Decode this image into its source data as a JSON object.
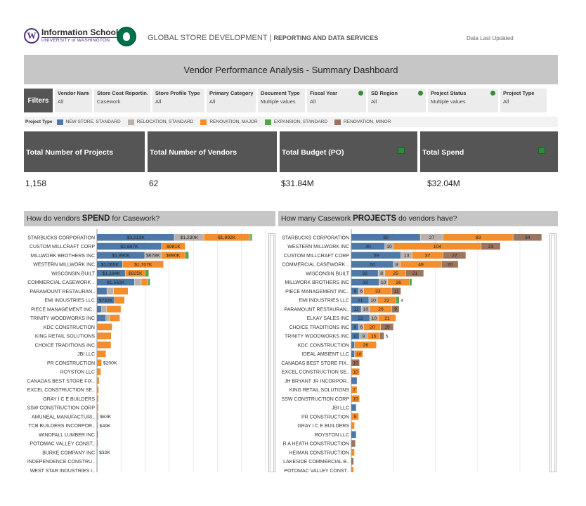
{
  "header": {
    "uw_name": "Information School",
    "uw_sub": "UNIVERSITY of WASHINGTON",
    "org_name": "GLOBAL STORE DEVELOPMENT",
    "org_sub": "REPORTING AND DATA SERVICES",
    "data_updated": "Data Last Updated"
  },
  "title": "Vendor Performance Analysis - Summary Dashboard",
  "filters": {
    "label": "Filters",
    "items": [
      {
        "title": "Vendor Name",
        "value": "All",
        "info": false
      },
      {
        "title": "Store Cost Reportin..",
        "value": "Casework",
        "info": false
      },
      {
        "title": "Store Profile Type",
        "value": "All",
        "info": false
      },
      {
        "title": "Primary Category",
        "value": "All",
        "info": false
      },
      {
        "title": "Document Type",
        "value": "Multiple values",
        "info": false
      },
      {
        "title": "Fiscal Year",
        "value": "All",
        "info": true
      },
      {
        "title": "SD Region",
        "value": "All",
        "info": true
      },
      {
        "title": "Project Status",
        "value": "Multiple values",
        "info": true
      },
      {
        "title": "Project Type",
        "value": "All",
        "info": false
      }
    ]
  },
  "legend": {
    "title": "Project Type",
    "items": [
      {
        "label": "NEW STORE, STANDARD",
        "color": "#4e79a7"
      },
      {
        "label": "RELOCATION, STANDARD",
        "color": "#bab0ac"
      },
      {
        "label": "RENOVATION, MAJOR",
        "color": "#f28e2b"
      },
      {
        "label": "EXPANSION, STANDARD",
        "color": "#59a14f"
      },
      {
        "label": "RENOVATION, MINOR",
        "color": "#9c755f"
      }
    ]
  },
  "kpis": [
    {
      "label": "Total Number of Projects",
      "value": "1,158"
    },
    {
      "label": "Total Number of Vendors",
      "value": "62"
    },
    {
      "label": "Total Budget (PO)",
      "value": "$31.84M"
    },
    {
      "label": "Total Spend",
      "value": "$32.04M"
    }
  ],
  "spend_panel": {
    "pre": "How do vendors ",
    "bold": "SPEND",
    "post": " for Casework?"
  },
  "projects_panel": {
    "pre": "How many Casework ",
    "bold": "PROJECTS",
    "post": " do vendors have?"
  },
  "chart_data": [
    {
      "type": "bar",
      "orientation": "horizontal",
      "stacked": true,
      "title": "How do vendors SPEND for Casework?",
      "units": "$K",
      "series_order": [
        "NEW STORE, STANDARD",
        "RELOCATION, STANDARD",
        "RENOVATION, MAJOR",
        "EXPANSION, STANDARD",
        "RENOVATION, MINOR"
      ],
      "categories": [
        "STARBUCKS CORPORATION",
        "CUSTOM MILLCRAFT CORP",
        "MILLWORK BROTHERS INC",
        "WESTERN MILLWORK INC",
        "WISCONSIN BUILT",
        "COMMERCIAL CASEWORK ..",
        "PARAMOUNT RESTAURAN..",
        "EMI INDUSTRIES LLC",
        "PIECE MANAGEMENT INC..",
        "TRINITY WOODWORKS INC",
        "KDC CONSTRUCTION",
        "KING RETAIL SOLUTIONS",
        "CHOICE TRADITIONS INC",
        "JBI LLC",
        "PR CONSTRUCTION",
        "ROYSTON LLC",
        "CANADAS BEST STORE FIX..",
        "EXCEL CONSTRUCTION SE..",
        "GRAY I C E BUILDERS",
        "SSW CONSTRUCTION CORP",
        "AMUNEAL MANUFACTURI..",
        "TCB BUILDERS INCORPOR..",
        "WINDFALL LUMBER INC",
        "POTOMAC VALLEY CONST..",
        "BURKE COMPANY INC",
        "INDEPENDENCE CONSTRU..",
        "WEST STAR INDUSTRIES I.."
      ],
      "values": [
        [
          3213,
          1230,
          1892,
          60,
          60
        ],
        [
          2687,
          0,
          981,
          0,
          0
        ],
        [
          1990,
          678,
          990,
          160,
          0
        ],
        [
          1065,
          0,
          1707,
          0,
          0
        ],
        [
          1184,
          0,
          825,
          150,
          0
        ],
        [
          1562,
          280,
          280,
          90,
          0
        ],
        [
          420,
          280,
          600,
          0,
          0
        ],
        [
          732,
          0,
          420,
          0,
          0
        ],
        [
          200,
          200,
          600,
          0,
          0
        ],
        [
          380,
          150,
          430,
          0,
          0
        ],
        [
          0,
          0,
          640,
          0,
          0
        ],
        [
          0,
          0,
          600,
          0,
          0
        ],
        [
          0,
          0,
          590,
          0,
          0
        ],
        [
          0,
          0,
          380,
          0,
          0
        ],
        [
          0,
          0,
          200,
          0,
          0
        ],
        [
          0,
          0,
          170,
          0,
          0
        ],
        [
          0,
          0,
          100,
          0,
          0
        ],
        [
          0,
          0,
          80,
          0,
          0
        ],
        [
          0,
          0,
          70,
          0,
          0
        ],
        [
          0,
          0,
          65,
          0,
          0
        ],
        [
          0,
          0,
          63,
          0,
          0
        ],
        [
          0,
          0,
          49,
          0,
          0
        ],
        [
          45,
          0,
          0,
          0,
          0
        ],
        [
          40,
          0,
          0,
          0,
          0
        ],
        [
          32,
          0,
          0,
          0,
          0
        ],
        [
          25,
          0,
          0,
          0,
          0
        ],
        [
          20,
          0,
          0,
          0,
          0
        ]
      ],
      "labels": [
        [
          "$3,213K",
          "$1,230K",
          "$1,892K",
          "",
          ""
        ],
        [
          "$2,687K",
          "",
          "$981K",
          "",
          ""
        ],
        [
          "$1,990K",
          "$678K",
          "$990K",
          "",
          ""
        ],
        [
          "$1,065K",
          "",
          "$1,707K",
          "",
          ""
        ],
        [
          "$1,184K",
          "",
          "$825K",
          "",
          ""
        ],
        [
          "$1,562K",
          "",
          "",
          "",
          ""
        ],
        [
          "",
          "",
          "",
          "",
          ""
        ],
        [
          "$732K",
          "",
          "",
          "",
          ""
        ],
        [
          "",
          "",
          "",
          "",
          ""
        ],
        [
          "",
          "",
          "",
          "",
          ""
        ],
        [
          "",
          "",
          "",
          "",
          ""
        ],
        [
          "",
          "",
          "",
          "",
          ""
        ],
        [
          "",
          "",
          "",
          "",
          ""
        ],
        [
          "",
          "",
          "",
          "",
          ""
        ],
        [
          "",
          "",
          "$200K",
          "",
          ""
        ],
        [
          "",
          "",
          "",
          "",
          ""
        ],
        [
          "",
          "",
          "",
          "",
          ""
        ],
        [
          "",
          "",
          "",
          "",
          ""
        ],
        [
          "",
          "",
          "",
          "",
          ""
        ],
        [
          "",
          "",
          "",
          "",
          ""
        ],
        [
          "",
          "",
          "$63K",
          "",
          ""
        ],
        [
          "",
          "",
          "$49K",
          "",
          ""
        ],
        [
          "",
          "",
          "",
          "",
          ""
        ],
        [
          "",
          "",
          "",
          "",
          ""
        ],
        [
          "$32K",
          "",
          "",
          "",
          ""
        ],
        [
          "",
          "",
          "",
          "",
          ""
        ],
        [
          "",
          "",
          "",
          "",
          ""
        ]
      ],
      "xlim": [
        0,
        7000
      ]
    },
    {
      "type": "bar",
      "orientation": "horizontal",
      "stacked": true,
      "title": "How many Casework PROJECTS do vendors have?",
      "series_order": [
        "NEW STORE, STANDARD",
        "RELOCATION, STANDARD",
        "RENOVATION, MAJOR",
        "EXPANSION, STANDARD",
        "RENOVATION, MINOR"
      ],
      "categories": [
        "STARBUCKS CORPORATION",
        "WESTERN MILLWORK INC",
        "CUSTOM MILLCRAFT CORP",
        "COMMERCIAL CASEWORK ..",
        "WISCONSIN BUILT",
        "MILLWORK BROTHERS INC",
        "PIECE MANAGEMENT INC..",
        "EMI INDUSTRIES LLC",
        "PARAMOUNT RESTAURAN..",
        "ELKAY SALES INC",
        "CHOICE TRADITIONS INC",
        "TRINITY WOODWORKS INC",
        "KDC CONSTRUCTION",
        "IDEAL AMBIENT LLC",
        "CANADAS BEST STORE FIX..",
        "EXCEL CONSTRUCTION SE..",
        "JH BRYANT JR INCORPOR..",
        "KING RETAIL SOLUTIONS",
        "SSW CONSTRUCTION CORP",
        "JBI LLC",
        "PR CONSTRUCTION",
        "GRAY I C E BUILDERS",
        "ROYSTON LLC",
        "R A HEATH CONSTRUCTION",
        "HEIMAN CONSTRUCTION",
        "LAKESIDE COMMERCIAL B..",
        "POTOMAC VALLEY CONST.."
      ],
      "values": [
        [
          82,
          27,
          83,
          0,
          34
        ],
        [
          40,
          10,
          104,
          0,
          23
        ],
        [
          59,
          13,
          37,
          0,
          27
        ],
        [
          50,
          8,
          49,
          0,
          20
        ],
        [
          32,
          8,
          25,
          0,
          21
        ],
        [
          33,
          10,
          26,
          3,
          0
        ],
        [
          9,
          6,
          33,
          0,
          11
        ],
        [
          21,
          10,
          22,
          4,
          0
        ],
        [
          12,
          10,
          26,
          0,
          9
        ],
        [
          22,
          10,
          21,
          0,
          0
        ],
        [
          9,
          6,
          20,
          0,
          15
        ],
        [
          10,
          9,
          15,
          0,
          5
        ],
        [
          4,
          0,
          26,
          0,
          0
        ],
        [
          4,
          0,
          10,
          0,
          0
        ],
        [
          0,
          0,
          0,
          0,
          10
        ],
        [
          0,
          0,
          10,
          0,
          0
        ],
        [
          7,
          0,
          0,
          0,
          0
        ],
        [
          0,
          0,
          7,
          0,
          0
        ],
        [
          0,
          0,
          10,
          0,
          0
        ],
        [
          6,
          0,
          0,
          0,
          0
        ],
        [
          0,
          0,
          9,
          0,
          0
        ],
        [
          0,
          0,
          4,
          0,
          0
        ],
        [
          6,
          0,
          0,
          0,
          0
        ],
        [
          0,
          0,
          0,
          0,
          5
        ],
        [
          0,
          0,
          4,
          0,
          0
        ],
        [
          0,
          0,
          0,
          0,
          3
        ],
        [
          0,
          0,
          3,
          0,
          0
        ]
      ],
      "labels": [
        [
          "82",
          "27",
          "83",
          "",
          "34"
        ],
        [
          "40",
          "10",
          "104",
          "",
          "23"
        ],
        [
          "59",
          "13",
          "37",
          "",
          "27"
        ],
        [
          "50",
          "8",
          "49",
          "",
          "20"
        ],
        [
          "32",
          "8",
          "25",
          "",
          "21"
        ],
        [
          "33",
          "10",
          "26",
          "",
          ""
        ],
        [
          "9",
          "6",
          "33",
          "",
          "11"
        ],
        [
          "21",
          "10",
          "22",
          "4",
          ""
        ],
        [
          "12",
          "10",
          "26",
          "",
          "9"
        ],
        [
          "22",
          "10",
          "21",
          "",
          ""
        ],
        [
          "9",
          "6",
          "20",
          "",
          "15"
        ],
        [
          "10",
          "9",
          "15",
          "",
          "5"
        ],
        [
          "",
          "",
          "26",
          "",
          ""
        ],
        [
          "",
          "",
          "10",
          "",
          ""
        ],
        [
          "",
          "",
          "",
          "",
          "10"
        ],
        [
          "",
          "",
          "10",
          "",
          ""
        ],
        [
          "",
          "",
          "",
          "",
          ""
        ],
        [
          "",
          "",
          "7",
          "",
          ""
        ],
        [
          "",
          "",
          "10",
          "",
          ""
        ],
        [
          "",
          "",
          "",
          "",
          ""
        ],
        [
          "",
          "",
          "9",
          "",
          ""
        ],
        [
          "",
          "",
          "",
          "",
          ""
        ],
        [
          "",
          "",
          "",
          "",
          ""
        ],
        [
          "",
          "",
          "",
          "",
          ""
        ],
        [
          "",
          "",
          "",
          "",
          ""
        ],
        [
          "",
          "",
          "",
          "",
          ""
        ],
        [
          "",
          "",
          "",
          "",
          ""
        ]
      ],
      "xlim": [
        0,
        230
      ]
    }
  ]
}
